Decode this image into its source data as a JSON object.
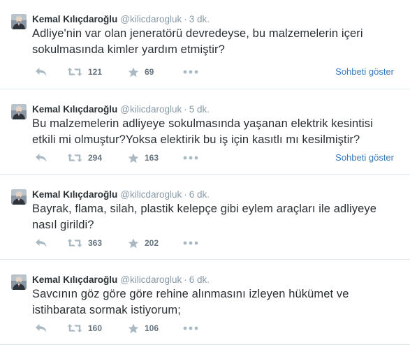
{
  "colors": {
    "link": "#3a7bbf",
    "muted": "#8899a6",
    "text": "#292f33",
    "action_icon": "#aab8c2",
    "divider": "#e1e8ed"
  },
  "icons": {
    "reply": "reply-icon",
    "retweet": "retweet-icon",
    "favorite": "star-icon",
    "more": "more-icon"
  },
  "tweets": [
    {
      "name": "Kemal Kılıçdaroğlu",
      "handle": "@kilicdarogluk",
      "separator": "·",
      "time": "3 dk.",
      "text": "Adliye'nin var olan jeneratörü devredeyse, bu malzemelerin içeri sokulmasında kimler yardım etmiştir?",
      "retweets": "121",
      "favorites": "69",
      "conversation": "Sohbeti göster"
    },
    {
      "name": "Kemal Kılıçdaroğlu",
      "handle": "@kilicdarogluk",
      "separator": "·",
      "time": "5 dk.",
      "text": "Bu malzemelerin adliyeye sokulmasında yaşanan elektrik kesintisi etkili mi olmuştur?Yoksa elektirik bu iş için kasıtlı mı kesilmiştir?",
      "retweets": "294",
      "favorites": "163",
      "conversation": "Sohbeti göster"
    },
    {
      "name": "Kemal Kılıçdaroğlu",
      "handle": "@kilicdarogluk",
      "separator": "·",
      "time": "6 dk.",
      "text": "Bayrak, flama, silah, plastik kelepçe gibi eylem araçları ile adliyeye nasıl girildi?",
      "retweets": "363",
      "favorites": "202",
      "conversation": ""
    },
    {
      "name": "Kemal Kılıçdaroğlu",
      "handle": "@kilicdarogluk",
      "separator": "·",
      "time": "6 dk.",
      "text": "Savcının göz göre göre rehine alınmasını izleyen hükümet ve istihbarata sormak istiyorum;",
      "retweets": "160",
      "favorites": "106",
      "conversation": ""
    }
  ]
}
